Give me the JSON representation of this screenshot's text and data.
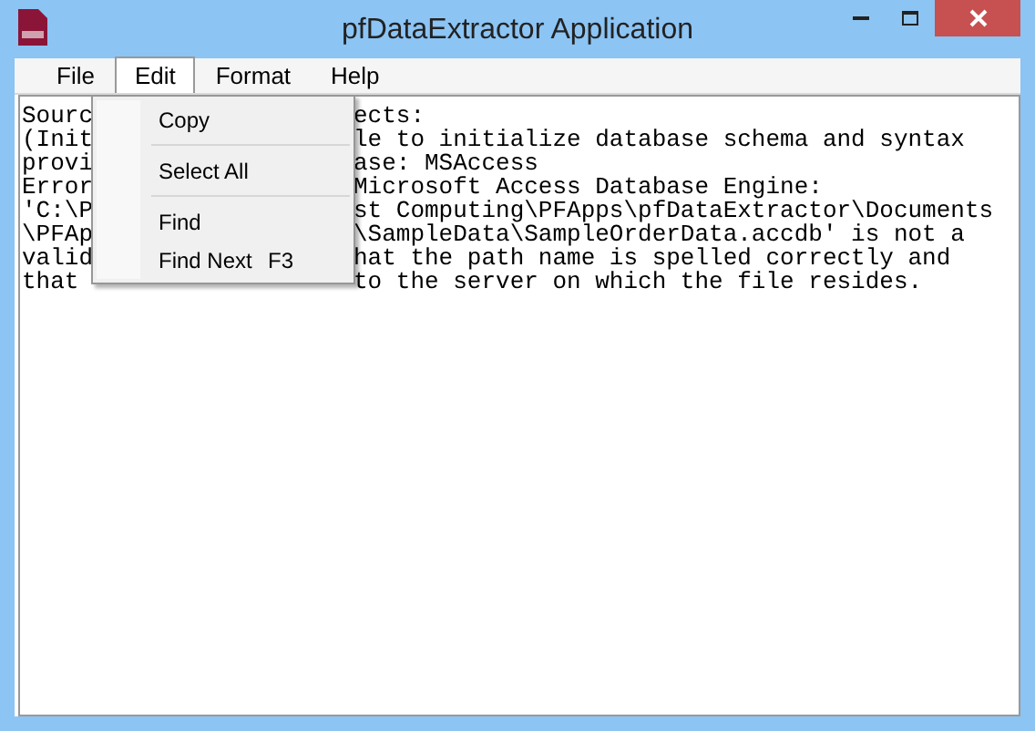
{
  "window": {
    "title": "pfDataExtractor Application"
  },
  "menu_bar": [
    {
      "label": "File",
      "selected": false
    },
    {
      "label": "Edit",
      "selected": true
    },
    {
      "label": "Format",
      "selected": false
    },
    {
      "label": "Help",
      "selected": false
    }
  ],
  "edit_menu": [
    {
      "kind": "item",
      "label": "Copy"
    },
    {
      "kind": "separator"
    },
    {
      "kind": "item",
      "label": "Select All"
    },
    {
      "kind": "separator"
    },
    {
      "kind": "item",
      "label": "Find"
    },
    {
      "kind": "item",
      "label": "Find Next",
      "shortcut": "F3"
    }
  ],
  "text_lines": [
    {
      "left": "Sourc",
      "right": "ects:"
    },
    {
      "left": "(Init",
      "right": "le to initialize database schema and syntax"
    },
    {
      "left": "provi",
      "right": "ase: MSAccess"
    },
    {
      "left": "Error",
      "right": "Microsoft Access Database Engine:"
    },
    {
      "left": "'C:\\P",
      "right": "st Computing\\PFApps\\pfDataExtractor\\Documents"
    },
    {
      "left": "\\PFAp",
      "right": "\\SampleData\\SampleOrderData.accdb' is not a"
    },
    {
      "left": "valid",
      "right": "hat the path name is spelled correctly and"
    },
    {
      "left": "that",
      "right": "to the server on which the file resides."
    }
  ]
}
